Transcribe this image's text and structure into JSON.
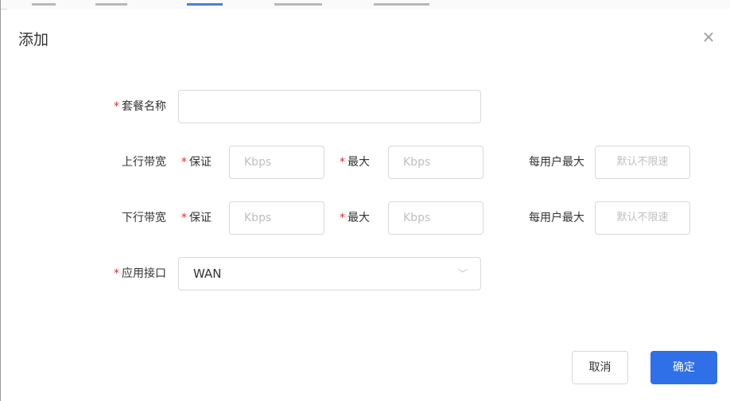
{
  "dialog": {
    "title": "添加",
    "close_glyph": "×"
  },
  "required_mark": "*",
  "package": {
    "label": "套餐名称",
    "value": ""
  },
  "up": {
    "row_label": "上行带宽",
    "guarantee_label": "保证",
    "guarantee_placeholder": "Kbps",
    "max_label": "最大",
    "max_placeholder": "Kbps",
    "per_user_label": "每用户最大",
    "per_user_placeholder": "默认不限速"
  },
  "down": {
    "row_label": "下行带宽",
    "guarantee_label": "保证",
    "guarantee_placeholder": "Kbps",
    "max_label": "最大",
    "max_placeholder": "Kbps",
    "per_user_label": "每用户最大",
    "per_user_placeholder": "默认不限速"
  },
  "interface": {
    "label": "应用接口",
    "value": "WAN",
    "chevron": "﹀"
  },
  "buttons": {
    "cancel": "取消",
    "ok": "确定"
  },
  "colors": {
    "primary": "#2f6fe8",
    "required": "#f5222d"
  }
}
